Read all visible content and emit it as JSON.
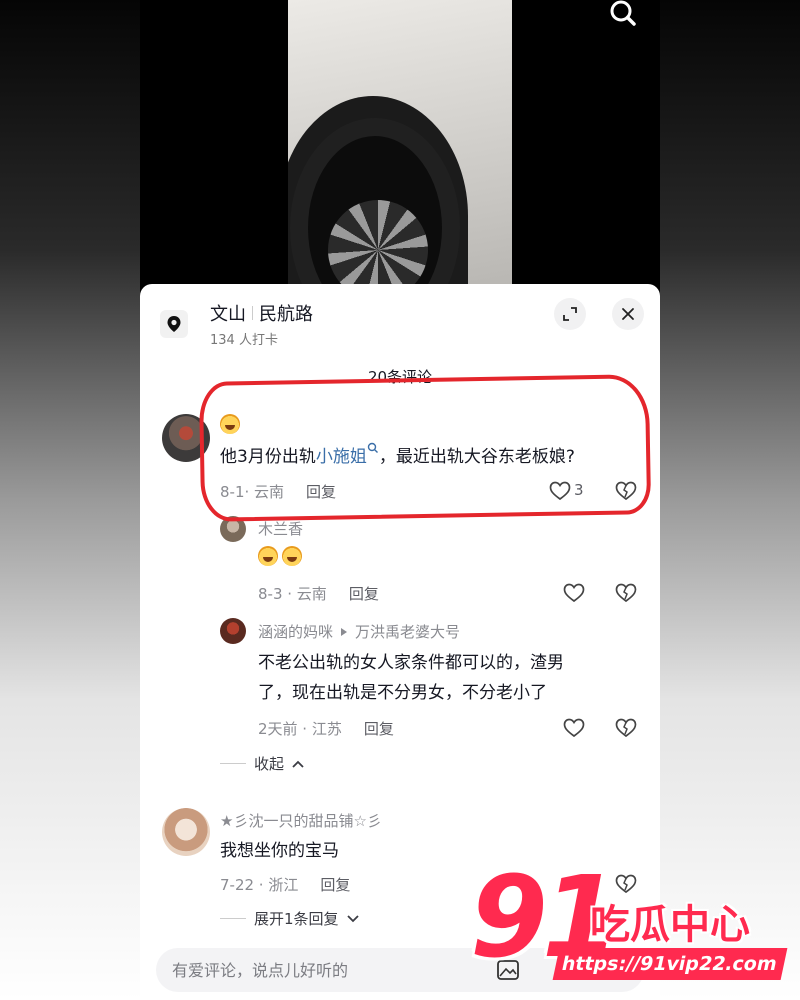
{
  "location": {
    "city": "文山",
    "road": "民航路",
    "checkins": "134 人打卡"
  },
  "comments_count": "20条评论",
  "comments": {
    "c1": {
      "text_pre": "他3月份出轨",
      "text_link": "小施姐",
      "text_post": "，最近出轨大谷东老板娘?",
      "meta_time": "8-1· 云南",
      "reply": "回复",
      "likes": "3"
    },
    "r1": {
      "name": "木兰香",
      "meta_time": "8-3 · 云南",
      "reply": "回复"
    },
    "r2": {
      "name": "涵涵的妈咪",
      "reply_to": "万洪禹老婆大号",
      "text_line1": "不老公出轨的女人家条件都可以的，渣男",
      "text_line2": "了，现在出轨是不分男女，不分老小了",
      "meta_time": "2天前 · 江苏",
      "reply": "回复"
    },
    "collapse": "收起",
    "c2": {
      "name": "★彡沈一只的甜品铺☆彡",
      "text": "我想坐你的宝马",
      "meta_time": "7-22 · 浙江",
      "reply": "回复"
    },
    "expand": "展开1条回复"
  },
  "input": {
    "placeholder": "有爱评论，说点儿好听的"
  },
  "watermark": {
    "number": "91",
    "brand": "吃瓜中心",
    "url": "https://91vip22.com"
  },
  "colors": {
    "highlight": "#e4262c",
    "watermark": "#ff2a4f",
    "link": "#3a6ea8"
  }
}
